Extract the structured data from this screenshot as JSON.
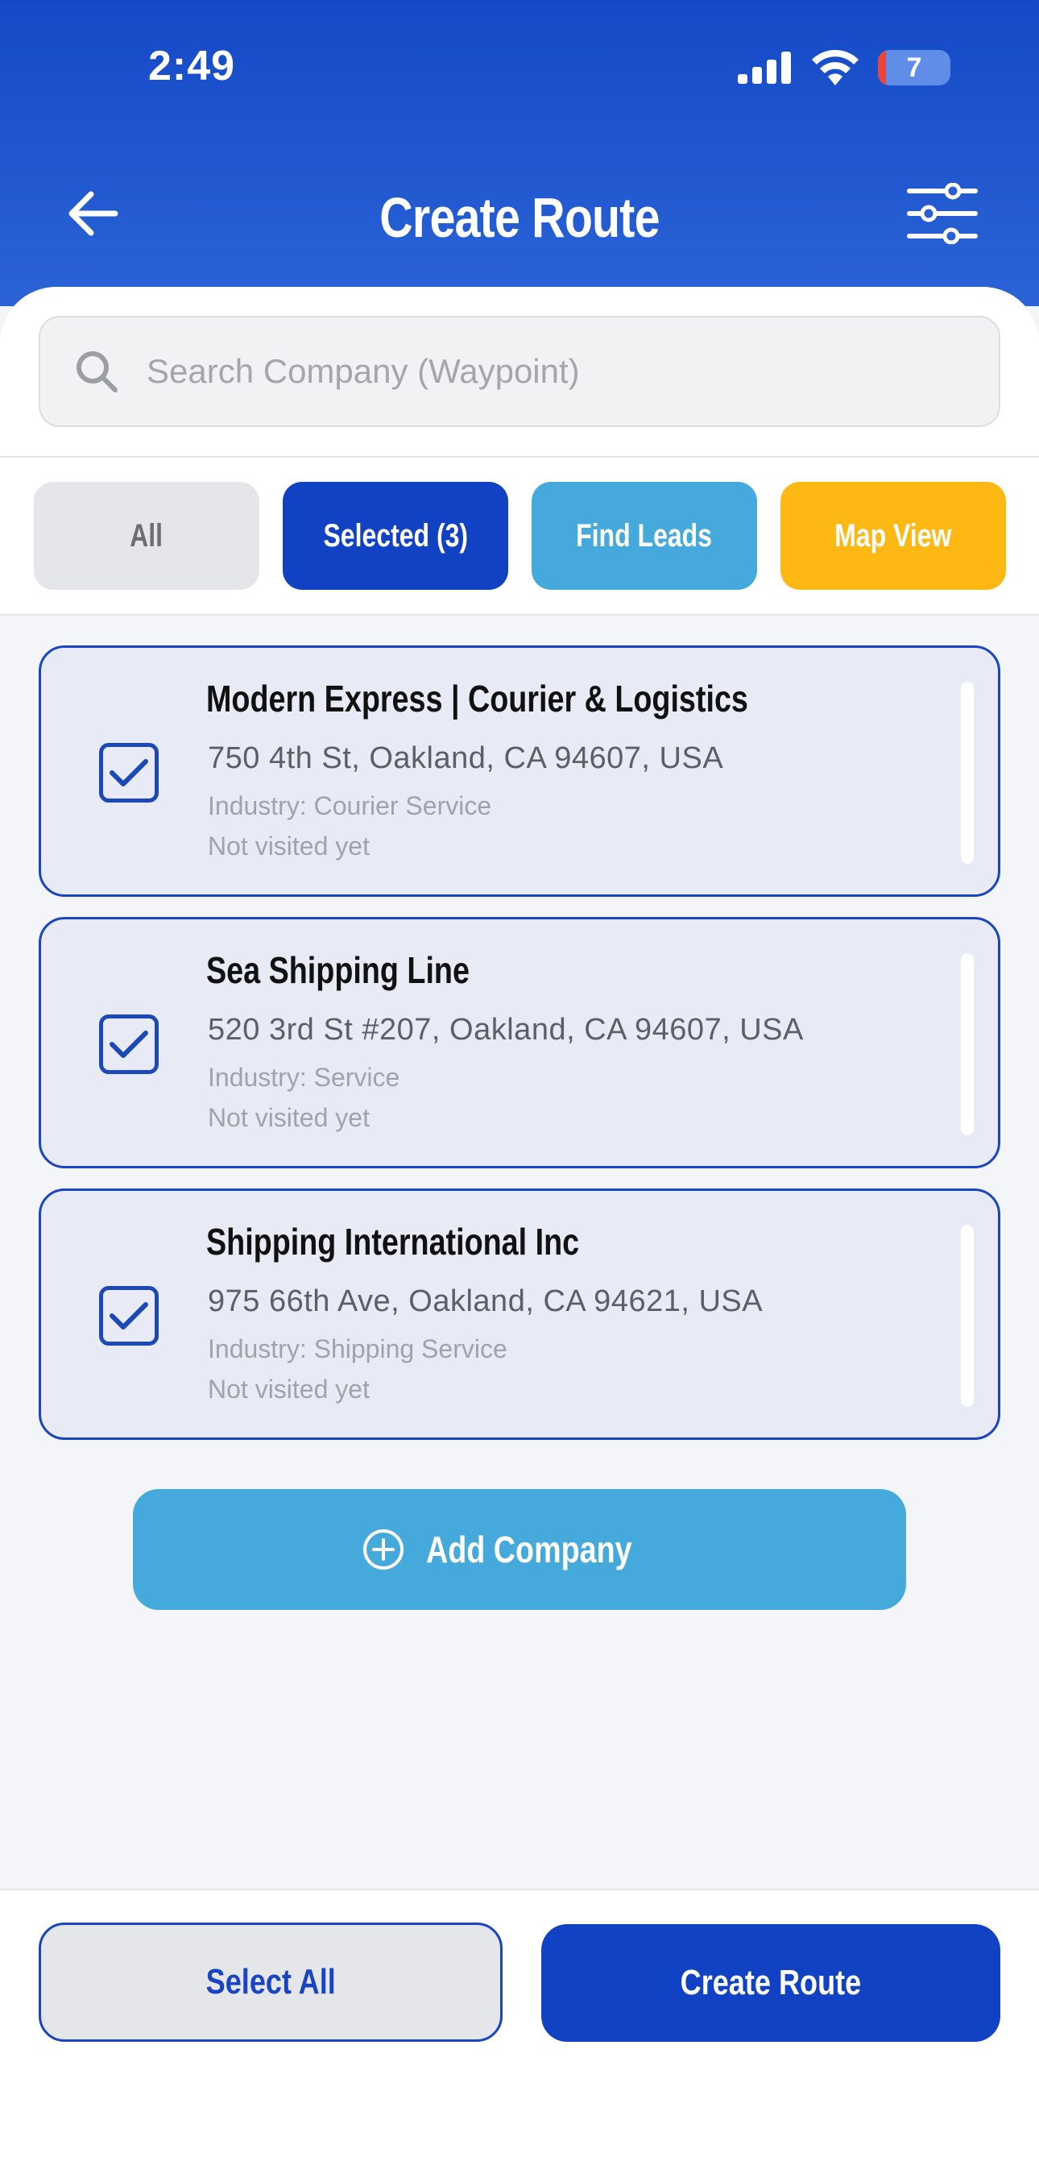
{
  "status_bar": {
    "time": "2:49",
    "battery_level": "7"
  },
  "header": {
    "title": "Create Route"
  },
  "search": {
    "placeholder": "Search Company (Waypoint)"
  },
  "tabs": [
    {
      "label": "All"
    },
    {
      "label": "Selected (3)"
    },
    {
      "label": "Find Leads"
    },
    {
      "label": "Map View"
    }
  ],
  "companies": [
    {
      "name": "Modern Express | Courier & Logistics",
      "address": "750 4th St, Oakland, CA 94607, USA",
      "industry": "Industry: Courier Service",
      "visit_status": "Not visited yet",
      "checked": true
    },
    {
      "name": "Sea Shipping Line",
      "address": "520 3rd St #207, Oakland, CA 94607, USA",
      "industry": "Industry: Service",
      "visit_status": "Not visited yet",
      "checked": true
    },
    {
      "name": "Shipping International Inc",
      "address": "975 66th Ave, Oakland, CA 94621, USA",
      "industry": "Industry: Shipping Service",
      "visit_status": "Not visited yet",
      "checked": true
    }
  ],
  "add_company": {
    "label": "Add Company"
  },
  "footer": {
    "select_all_label": "Select All",
    "create_route_label": "Create Route"
  },
  "colors": {
    "primary": "#1242c4",
    "accent_blue": "#45aadb",
    "accent_yellow": "#fdb813"
  }
}
